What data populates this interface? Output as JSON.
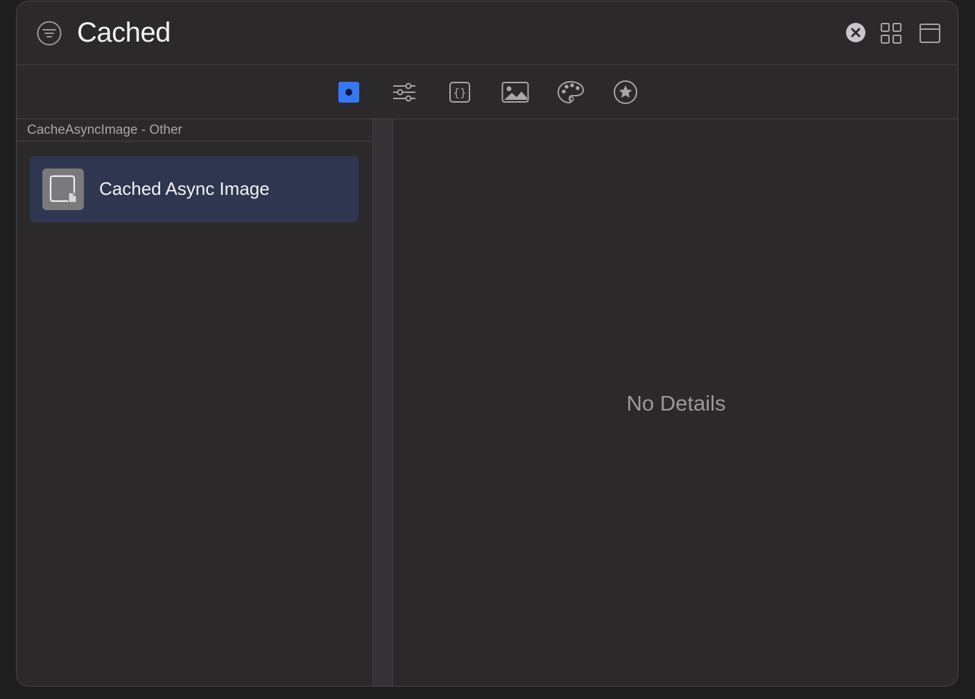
{
  "search": {
    "query": "Cached"
  },
  "icons": {
    "filter": "filter-circle-icon",
    "clear": "clear-circle-icon",
    "grid": "grid-view-icon",
    "layout": "window-layout-icon"
  },
  "tabs": [
    {
      "name": "components",
      "icon": "filled-square-dot-icon",
      "selected": true
    },
    {
      "name": "modifiers",
      "icon": "sliders-icon",
      "selected": false
    },
    {
      "name": "snippets",
      "icon": "braces-icon",
      "selected": false
    },
    {
      "name": "media",
      "icon": "image-icon",
      "selected": false
    },
    {
      "name": "colors",
      "icon": "palette-icon",
      "selected": false
    },
    {
      "name": "symbols",
      "icon": "star-circle-icon",
      "selected": false
    }
  ],
  "sidebar": {
    "group_header": "CacheAsyncImage - Other",
    "items": [
      {
        "label": "Cached Async Image",
        "icon": "file-component-icon",
        "selected": true
      }
    ]
  },
  "detail": {
    "empty_text": "No Details"
  },
  "colors": {
    "accent": "#3478f6",
    "selection": "#2e3650",
    "background": "#2c292b"
  }
}
